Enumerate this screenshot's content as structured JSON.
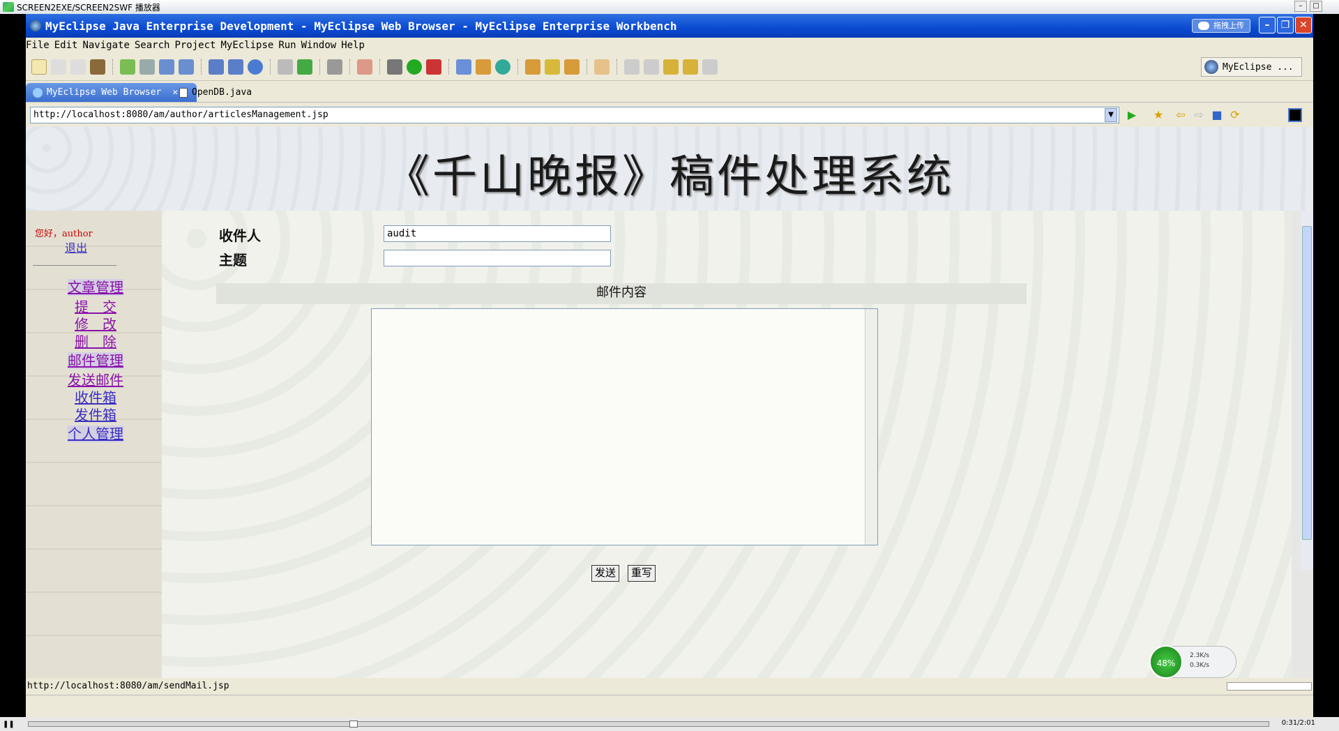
{
  "player": {
    "title": "SCREEN2EXE/SCREEN2SWF 播放器",
    "timecode": "0:31/2:01"
  },
  "window": {
    "title": "MyEclipse Java Enterprise Development - MyEclipse Web Browser - MyEclipse Enterprise Workbench",
    "upload_badge": "拖拽上传"
  },
  "menu": [
    "File",
    "Edit",
    "Navigate",
    "Search",
    "Project",
    "MyEclipse",
    "Run",
    "Window",
    "Help"
  ],
  "perspective": "MyEclipse ...",
  "tabs": [
    {
      "label": "MyEclipse Web Browser",
      "active": true
    },
    {
      "label": "OpenDB.java",
      "active": false
    }
  ],
  "browser": {
    "url": "http://localhost:8080/am/author/articlesManagement.jsp",
    "status_url": "http://localhost:8080/am/sendMail.jsp"
  },
  "page": {
    "title": "《千山晚报》稿件处理系统",
    "greeting": "您好，author",
    "logout": "退出",
    "nav": [
      {
        "label": "文章管理",
        "type": "section"
      },
      {
        "label": "提　交",
        "type": "item"
      },
      {
        "label": "修　改",
        "type": "item"
      },
      {
        "label": "删　除",
        "type": "item"
      },
      {
        "label": "邮件管理",
        "type": "section"
      },
      {
        "label": "发送邮件",
        "type": "item"
      },
      {
        "label": "收件箱",
        "type": "item"
      },
      {
        "label": "发件箱",
        "type": "item"
      },
      {
        "label": "个人管理",
        "type": "section"
      }
    ],
    "form": {
      "recipient_label": "收件人",
      "recipient_value": "audit",
      "subject_label": "主题",
      "subject_value": "",
      "body_label": "邮件内容",
      "send_button": "发送",
      "reset_button": "重写"
    }
  },
  "speed": {
    "percent": "48%",
    "up": "2.3K/s",
    "down": "0.3K/s"
  }
}
